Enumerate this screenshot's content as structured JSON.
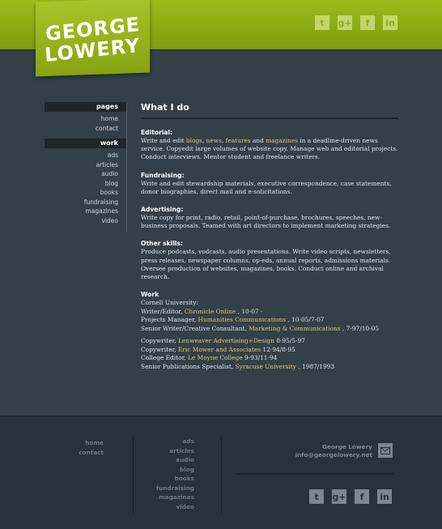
{
  "logo": {
    "line1": "GEORGE",
    "line2": "LOWERY"
  },
  "social": [
    {
      "icon": "twitter-icon",
      "glyph": "t"
    },
    {
      "icon": "google-plus-icon",
      "glyph": "g+"
    },
    {
      "icon": "facebook-icon",
      "glyph": "f"
    },
    {
      "icon": "linkedin-icon",
      "glyph": "in"
    }
  ],
  "sidebar": {
    "pages_heading": "pages",
    "pages": [
      "home",
      "contact"
    ],
    "work_heading": "work",
    "work": [
      "ads",
      "articles",
      "audio",
      "blog",
      "books",
      "fundraising",
      "magazines",
      "video"
    ]
  },
  "main": {
    "title": "What I do",
    "editorial": {
      "heading": "Editorial:",
      "pre": "Write and edit ",
      "link1": "blogs",
      "sep1": ", ",
      "link2": "news",
      "sep2": ", ",
      "link3": "features",
      "sep3": " and ",
      "link4": "magazines",
      "post": " in a deadline-driven news service. Copyedit large volumes of website copy. Manage web and editorial projects. Conduct interviews. Mentor student and freelance writers."
    },
    "fundraising": {
      "heading": "Fundraising:",
      "text": "Write and edit stewardship materials, executive correspondence, case statements, donor biographies, direct mail and e-solicitations."
    },
    "advertising": {
      "heading": "Advertising:",
      "text": "Write copy for print, radio, retail, point-of-purchase, brochures, speeches, new-business proposals. Teamed with art directors to implement marketing strategies."
    },
    "other": {
      "heading": "Other skills:",
      "text": "Produce podcasts, vodcasts, audio presentations. Write video scripts, newsletters, press releases, newspaper columns, op-eds, annual reports, admissions materials. Oversee production of websites, magazines, books. Conduct online and archival research."
    },
    "work": {
      "heading": "Work",
      "cornell": "Cornell University:",
      "l1_pre": "Writer/Editor, ",
      "l1_link": "Chronicle Online",
      "l1_post": " , 10-07 -",
      "l2_pre": "Projects Manager, ",
      "l2_link": "Humanities Communications",
      "l2_post": " , 10-05/7-07",
      "l3_pre": "Senior Writer/Creative Consultant, ",
      "l3_link": "Marketing & Communications",
      "l3_post": " , 7-97/10-05",
      "l4_pre": "Copywriter, ",
      "l4_link": "Lenweaver Advertising+Design",
      "l4_post": " 8-95/5-97",
      "l5_pre": "Copywriter, ",
      "l5_link": "Eric Mower and Associates",
      "l5_post": " 12-94/8-95",
      "l6_pre": "College Editor, ",
      "l6_link": "Le Moyne College",
      "l6_post": " 9-93/11-94",
      "l7_pre": "Senior Publications Specialist, ",
      "l7_link": "Syracuse University",
      "l7_post": " , 1987/1993"
    }
  },
  "footer": {
    "pages": [
      "home",
      "contact"
    ],
    "work": [
      "ads",
      "articles",
      "audio",
      "blog",
      "books",
      "fundraising",
      "magazines",
      "video"
    ],
    "name": "George Lowery",
    "email": "info@georgelowery.net"
  },
  "colors": {
    "accent": "#9dbb1a",
    "background": "#334048",
    "link": "#dec77a",
    "footer": "#27323a"
  }
}
